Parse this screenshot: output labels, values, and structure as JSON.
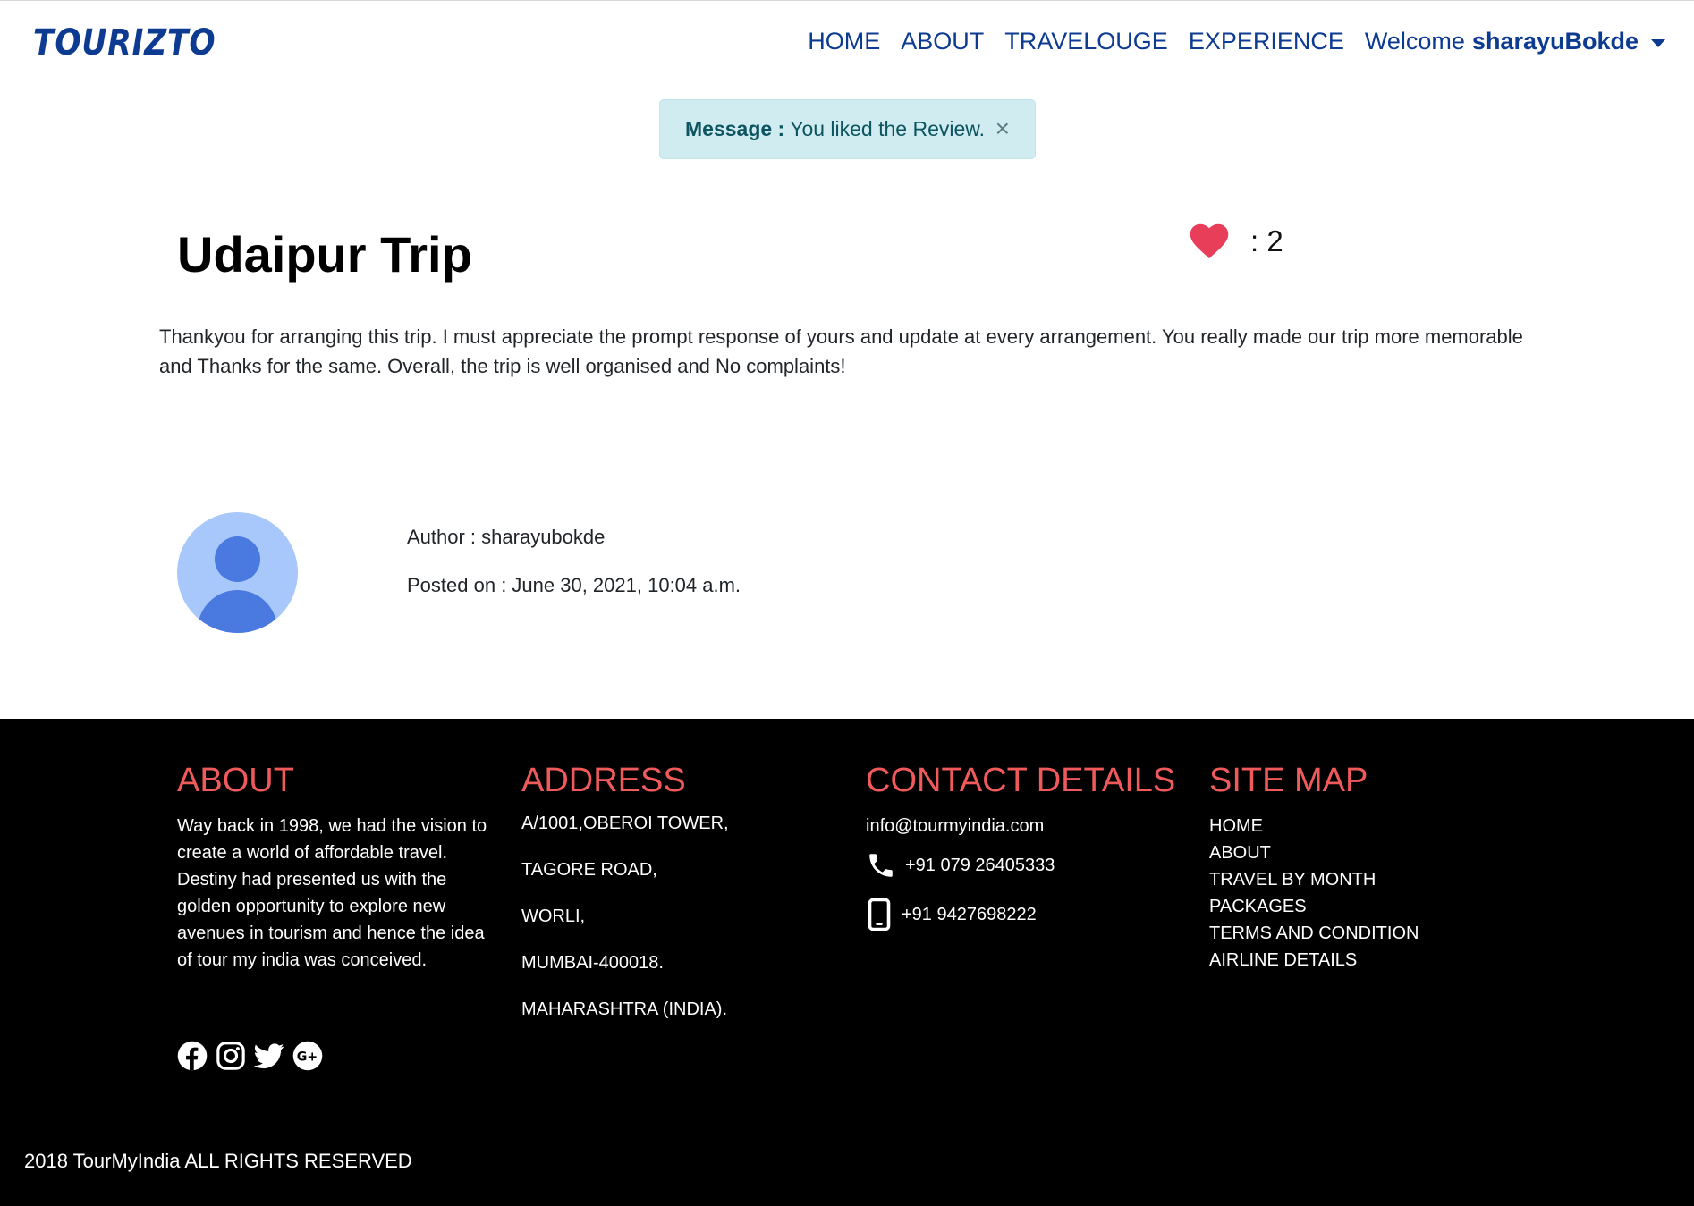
{
  "navbar": {
    "brand": "TOURIZTO",
    "links": [
      "HOME",
      "ABOUT",
      "TRAVELOUGE",
      "EXPERIENCE"
    ],
    "welcome": "Welcome",
    "username": "sharayuBokde"
  },
  "alert": {
    "label": "Message :",
    "text": "You liked the Review.",
    "close": "×"
  },
  "review": {
    "title": "Udaipur Trip",
    "like_count": ": 2",
    "body": "Thankyou for arranging this trip. I must appreciate the prompt response of yours and update at every arrangement. You really made our trip more memorable and Thanks for the same. Overall, the trip is well organised and No complaints!",
    "author": "Author : sharayubokde",
    "posted": "Posted on : June 30, 2021, 10:04 a.m."
  },
  "footer": {
    "about": {
      "heading": "ABOUT",
      "text": "Way back in 1998, we had the vision to create a world of affordable travel. Destiny had presented us with the golden opportunity to explore new avenues in tourism and hence the idea of tour my india was conceived."
    },
    "address": {
      "heading": "ADDRESS",
      "lines": [
        "A/1001,OBEROI TOWER,",
        "TAGORE ROAD,",
        "WORLI,",
        "MUMBAI-400018.",
        "MAHARASHTRA (INDIA)."
      ]
    },
    "contact": {
      "heading": "CONTACT DETAILS",
      "email": "info@tourmyindia.com",
      "phone": "+91 079 26405333",
      "mobile": "+91 9427698222"
    },
    "sitemap": {
      "heading": "SITE MAP",
      "items": [
        "HOME",
        "ABOUT",
        "TRAVEL BY MONTH",
        "PACKAGES",
        "TERMS AND CONDITION",
        "AIRLINE DETAILS"
      ]
    },
    "social_icons": [
      "facebook-icon",
      "instagram-icon",
      "twitter-icon",
      "google-plus-icon"
    ],
    "copyright": "2018 TourMyIndia ALL RIGHTS RESERVED"
  },
  "colors": {
    "brand": "#0d3b91",
    "accent_heading": "#f05a5b",
    "heart": "#e83e5a",
    "alert_bg": "#d1ecf1",
    "footer_bg": "#000000"
  }
}
